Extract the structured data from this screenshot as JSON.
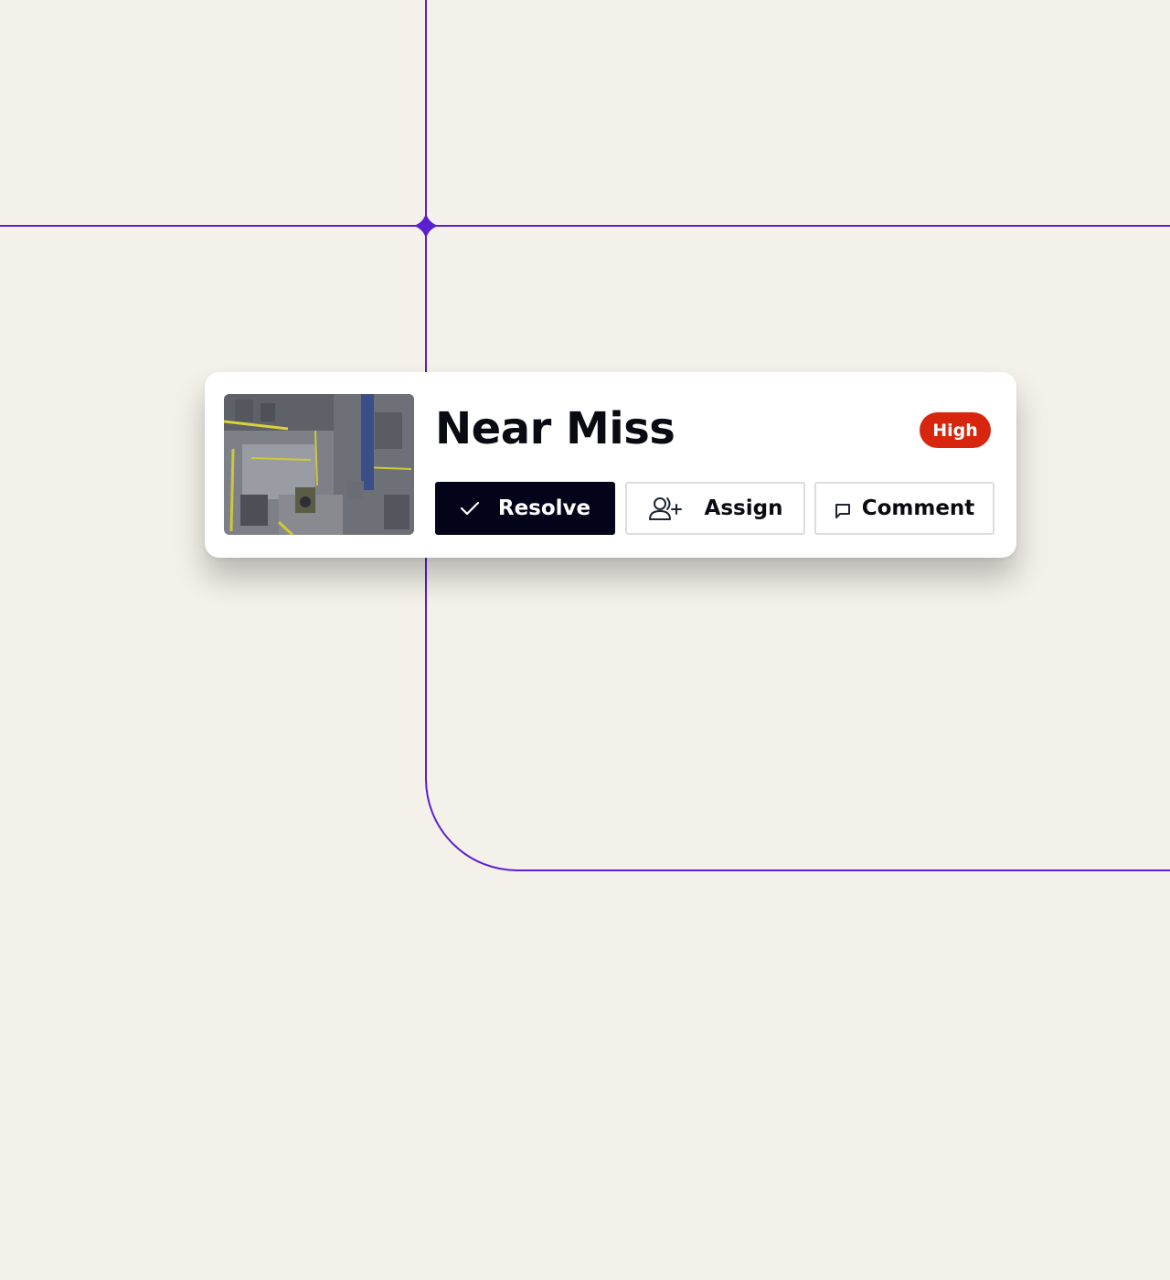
{
  "colors": {
    "background": "#f4f1ea",
    "accent_line": "#5a1fd0",
    "primary_button": "#03031a",
    "severity_high": "#d7260d"
  },
  "incident": {
    "title": "Near Miss",
    "severity": "High",
    "thumbnail_icon": "warehouse-overhead-camera-thumbnail"
  },
  "actions": {
    "resolve": {
      "label": "Resolve",
      "icon": "check-icon"
    },
    "assign": {
      "label": "Assign",
      "icon": "user-add-icon"
    },
    "comment": {
      "label": "Comment",
      "icon": "comment-icon"
    }
  }
}
